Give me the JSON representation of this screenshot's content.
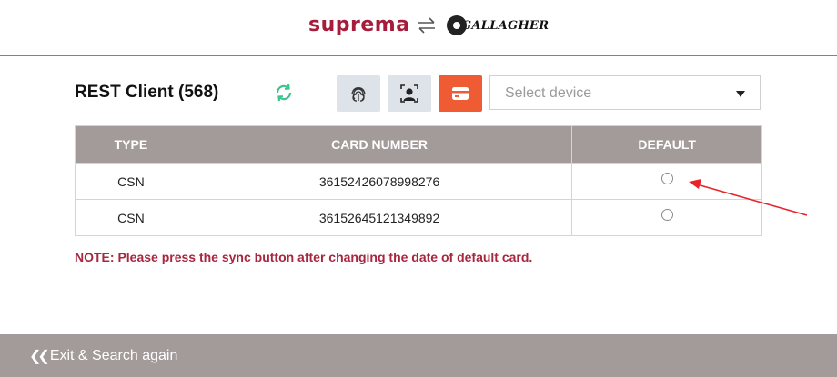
{
  "header": {
    "brand_left": "suprema",
    "brand_right": "GALLAGHER"
  },
  "page": {
    "title": "REST Client (568)",
    "select_placeholder": "Select device"
  },
  "table": {
    "headers": [
      "TYPE",
      "CARD NUMBER",
      "DEFAULT"
    ],
    "rows": [
      {
        "type": "CSN",
        "card_number": "36152426078998276",
        "default_selected": false
      },
      {
        "type": "CSN",
        "card_number": "36152645121349892",
        "default_selected": false
      }
    ]
  },
  "note": "NOTE: Please press the sync button after changing the date of default card.",
  "footer": {
    "exit_label": "Exit & Search again"
  },
  "colors": {
    "brand": "#a51d3a",
    "accent_orange": "#ef5b33",
    "header_grey": "#a39a9a",
    "sync_green": "#3cc48c",
    "annotation_red": "#e8232a"
  },
  "icons": [
    "swap-arrows-icon",
    "sync-icon",
    "fingerprint-icon",
    "face-icon",
    "card-icon",
    "chevron-double-left-icon"
  ]
}
